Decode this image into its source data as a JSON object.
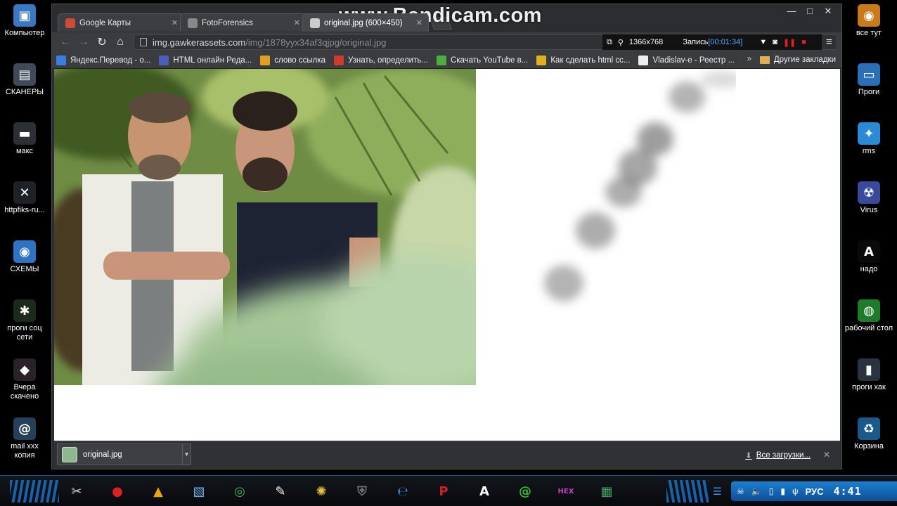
{
  "watermark": "www.Bandicam.com",
  "desktop_left": [
    {
      "label": "Компьютер",
      "icon": "computer-icon",
      "color": "#3a78c2",
      "glyph": "▣"
    },
    {
      "label": "СКАНЕРЫ",
      "icon": "scanner-icon",
      "color": "#404a58",
      "glyph": "▤"
    },
    {
      "label": "макс",
      "icon": "folder-icon",
      "color": "#2c3036",
      "glyph": "▬"
    },
    {
      "label": "httpfiks-ru...",
      "icon": "tools-icon",
      "color": "#1e2226",
      "glyph": "✕"
    },
    {
      "label": "СХЕМЫ",
      "icon": "globe-icon",
      "color": "#2f74c4",
      "glyph": "◉"
    },
    {
      "label": "проги соц сети",
      "icon": "spider-icon",
      "color": "#1c2a1c",
      "glyph": "✱"
    },
    {
      "label": "Вчера скачено",
      "icon": "download-icon",
      "color": "#2a2228",
      "glyph": "◆"
    },
    {
      "label": "mail xxx копия",
      "icon": "mail-icon",
      "color": "#26405a",
      "glyph": "@"
    }
  ],
  "desktop_right": [
    {
      "label": "все тут",
      "icon": "globe-folder-icon",
      "color": "#c87a1c",
      "glyph": "◉"
    },
    {
      "label": "Проги",
      "icon": "monitor-icon",
      "color": "#2b6fb8",
      "glyph": "▭"
    },
    {
      "label": "rms",
      "icon": "network-icon",
      "color": "#2b8ad8",
      "glyph": "✦"
    },
    {
      "label": "Virus",
      "icon": "virus-icon",
      "color": "#3a4a9a",
      "glyph": "☢"
    },
    {
      "label": "надо",
      "icon": "font-a-icon",
      "color": "#0a0a0a",
      "glyph": "A"
    },
    {
      "label": "рабочий стол",
      "icon": "green-globe-icon",
      "color": "#1f7a2a",
      "glyph": "◍"
    },
    {
      "label": "проги хак",
      "icon": "folder-dark-icon",
      "color": "#2a3440",
      "glyph": "▮"
    },
    {
      "label": "Корзина",
      "icon": "recycle-bin-icon",
      "color": "#1a5a8a",
      "glyph": "♻"
    }
  ],
  "browser": {
    "tabs": [
      {
        "title": "Google Карты",
        "icon": "google-maps-icon",
        "color": "#d04a3a",
        "active": false
      },
      {
        "title": "FotoForensics",
        "icon": "fotoforensics-icon",
        "color": "#888888",
        "active": false
      },
      {
        "title": "original.jpg (600×450)",
        "icon": "page-icon",
        "color": "#cccccc",
        "active": true
      }
    ],
    "url_host": "img.gawkerassets.com",
    "url_path": "/img/1878yyx34af3qjpg/original.jpg",
    "recorder": {
      "resolution": "1366x768",
      "label": "Запись",
      "time": "[00:01:34]"
    },
    "bookmarks": [
      {
        "label": "Яндекс.Перевод - о...",
        "icon": "yandex-translate-icon",
        "color": "#3b7ddd"
      },
      {
        "label": "HTML онлайн Реда...",
        "icon": "html-editor-icon",
        "color": "#4b5fb8"
      },
      {
        "label": "слово ссылка",
        "icon": "link-word-icon",
        "color": "#e0a020"
      },
      {
        "label": "Узнать, определить...",
        "icon": "find-out-icon",
        "color": "#d03a2a"
      },
      {
        "label": "Скачать YouTube в...",
        "icon": "youtube-download-icon",
        "color": "#4cae3c"
      },
      {
        "label": "Как сделать html сс...",
        "icon": "how-to-icon",
        "color": "#e0b020"
      },
      {
        "label": "Vladislav-e - Реестр ...",
        "icon": "registry-icon",
        "color": "#eeeeee"
      }
    ],
    "bookmarks_more": "»",
    "other_bookmarks": "Другие закладки",
    "download": {
      "filename": "original.jpg",
      "show_all": "Все загрузки..."
    }
  },
  "taskbar": {
    "apps": [
      {
        "icon": "scissors-app-icon",
        "color": "#d0d0d0",
        "glyph": "✂"
      },
      {
        "icon": "record-app-icon",
        "color": "#e02020",
        "glyph": "●"
      },
      {
        "icon": "warning-app-icon",
        "color": "#f0a010",
        "glyph": "▲"
      },
      {
        "icon": "files-app-icon",
        "color": "#6ab0e8",
        "glyph": "▧"
      },
      {
        "icon": "chrome-app-icon",
        "color": "#4caf50",
        "glyph": "◎"
      },
      {
        "icon": "notepad-app-icon",
        "color": "#f4f4e8",
        "glyph": "✎"
      },
      {
        "icon": "wheel-app-icon",
        "color": "#e8c040",
        "glyph": "✺"
      },
      {
        "icon": "tanks-app-icon",
        "color": "#707070",
        "glyph": "⛨"
      },
      {
        "icon": "ie-app-icon",
        "color": "#3a8ae0",
        "glyph": "℮"
      },
      {
        "icon": "pinterest-app-icon",
        "color": "#d0202a",
        "glyph": "P"
      },
      {
        "icon": "font-app-icon",
        "color": "#ffffff",
        "glyph": "A"
      },
      {
        "icon": "email-app-icon",
        "color": "#30c030",
        "glyph": "@"
      },
      {
        "icon": "hex-editor-app-icon",
        "color": "#c040c0",
        "glyph": "HEX"
      },
      {
        "icon": "image-viewer-app-icon",
        "color": "#40a060",
        "glyph": "▦"
      }
    ],
    "language": "РУС",
    "clock": "4:41"
  }
}
